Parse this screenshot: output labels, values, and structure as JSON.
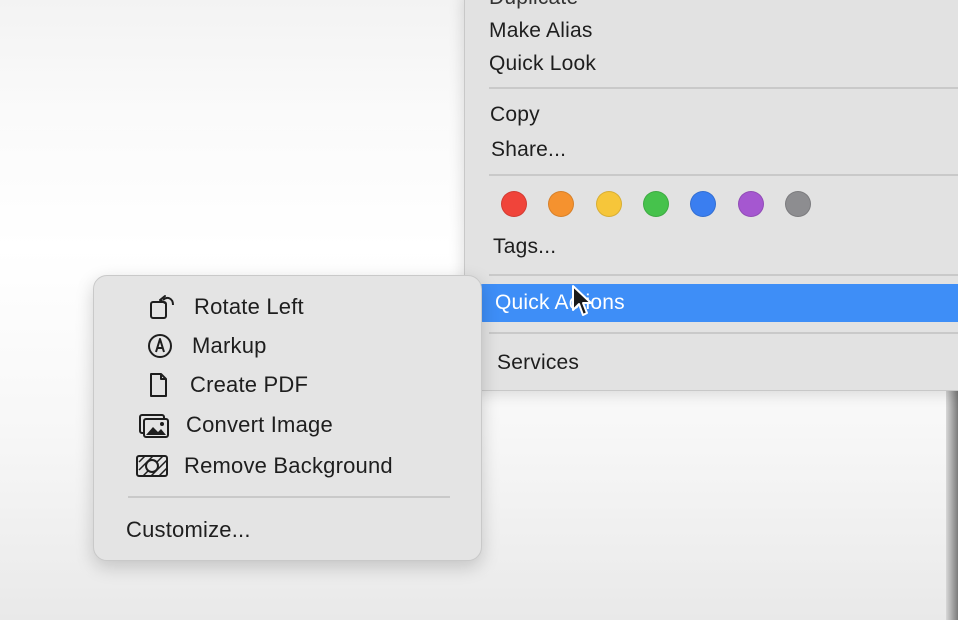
{
  "context_menu": {
    "items_top": [
      {
        "label": "Duplicate"
      },
      {
        "label": "Make Alias"
      },
      {
        "label": "Quick Look"
      }
    ],
    "items_share": [
      {
        "label": "Copy"
      },
      {
        "label": "Share..."
      }
    ],
    "tags": [
      {
        "name": "red",
        "color": "#f0443a"
      },
      {
        "name": "orange",
        "color": "#f5922f"
      },
      {
        "name": "yellow",
        "color": "#f6c63a"
      },
      {
        "name": "green",
        "color": "#46c24c"
      },
      {
        "name": "blue",
        "color": "#3a7ef0"
      },
      {
        "name": "purple",
        "color": "#a557d0"
      },
      {
        "name": "gray",
        "color": "#8d8d90"
      }
    ],
    "tags_label": "Tags...",
    "quick_actions_label": "Quick Actions",
    "services_label": "Services",
    "highlight_color": "#3e8ef7"
  },
  "submenu": {
    "items": [
      {
        "label": "Rotate Left",
        "icon": "rotate-left-icon"
      },
      {
        "label": "Markup",
        "icon": "markup-icon"
      },
      {
        "label": "Create PDF",
        "icon": "document-icon"
      },
      {
        "label": "Convert Image",
        "icon": "photo-stack-icon"
      },
      {
        "label": "Remove Background",
        "icon": "remove-background-icon"
      }
    ],
    "customize_label": "Customize..."
  }
}
